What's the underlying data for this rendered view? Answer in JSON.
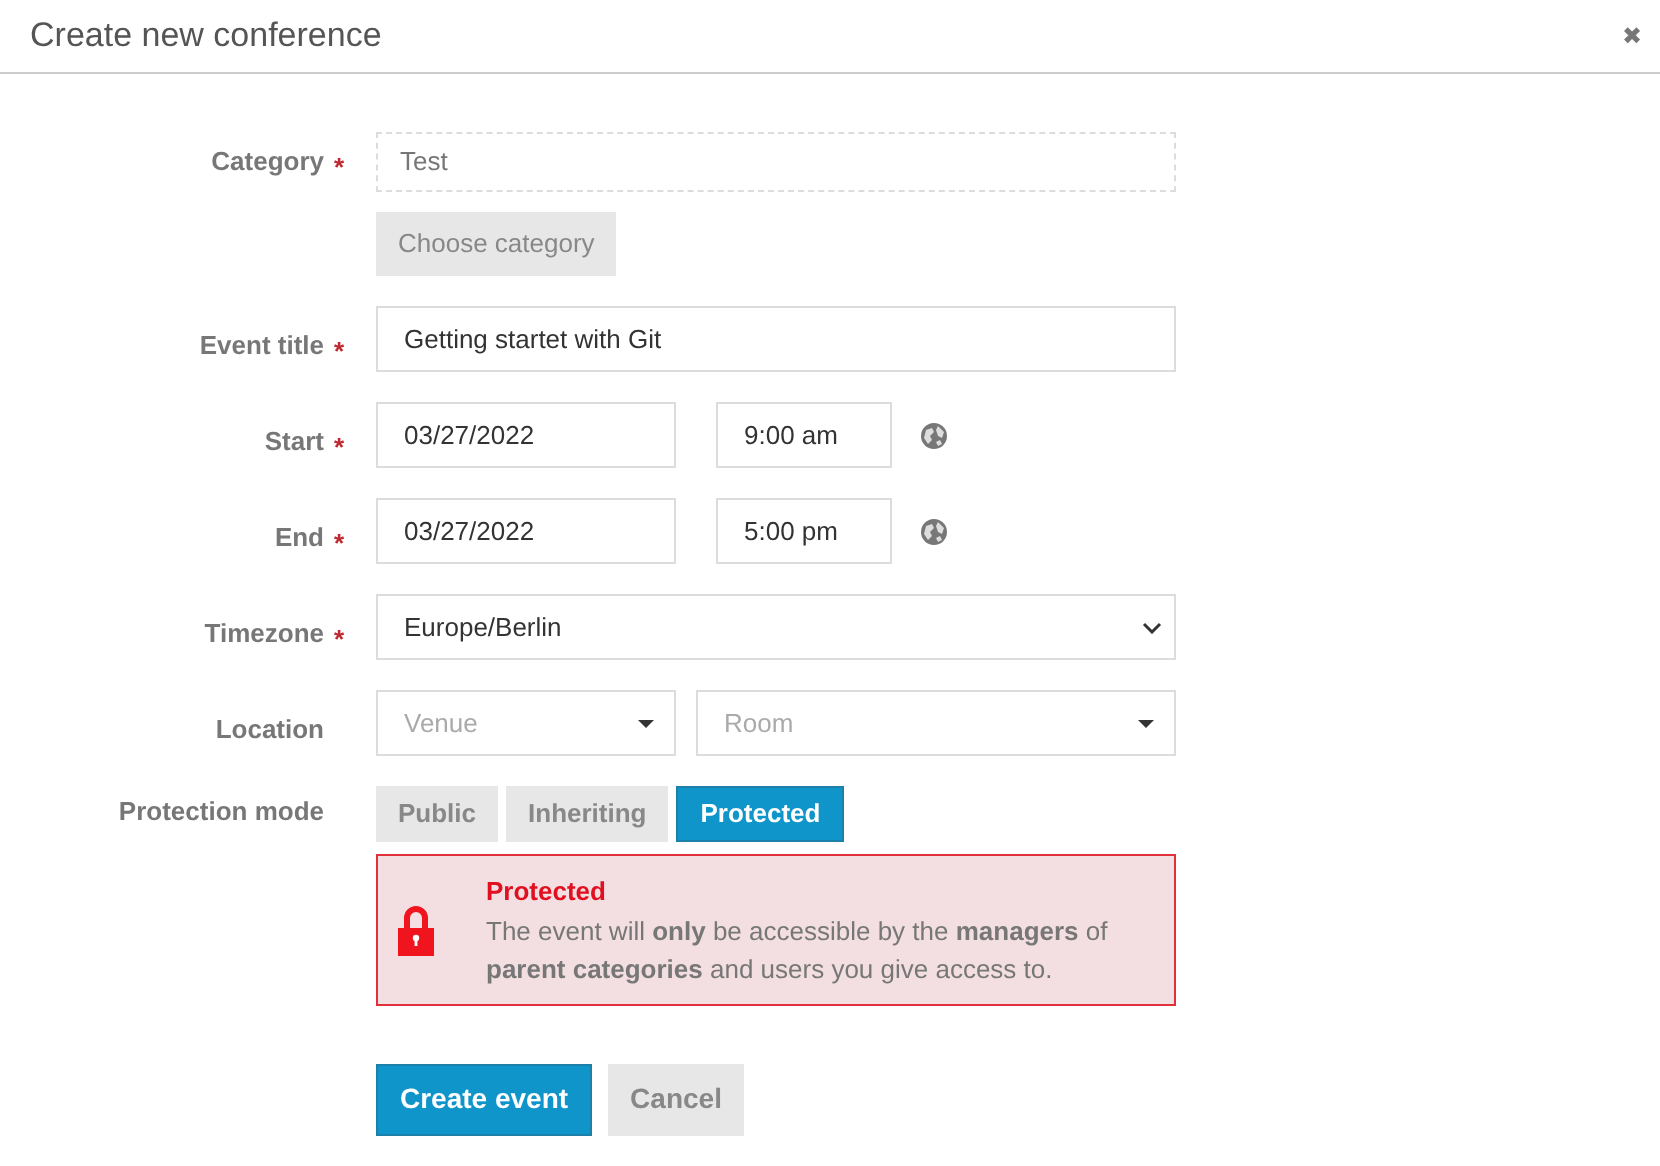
{
  "dialog": {
    "title": "Create new conference",
    "close": "✖"
  },
  "fields": [
    {
      "kind": "category",
      "label": "Category",
      "required": true,
      "value": "Test",
      "button": "Choose category"
    },
    {
      "kind": "text",
      "label": "Event title",
      "required": true,
      "value": "Getting startet with Git"
    },
    {
      "kind": "datetime",
      "label": "Start",
      "required": true,
      "date": "03/27/2022",
      "time": "9:00 am"
    },
    {
      "kind": "datetime",
      "label": "End",
      "required": true,
      "date": "03/27/2022",
      "time": "5:00 pm"
    },
    {
      "kind": "select",
      "label": "Timezone",
      "required": true,
      "value": "Europe/Berlin"
    },
    {
      "kind": "location",
      "label": "Location",
      "required": false,
      "venue_placeholder": "Venue",
      "room_placeholder": "Room"
    },
    {
      "kind": "protection",
      "label": "Protection mode",
      "required": false,
      "options": [
        {
          "label": "Public",
          "selected": false
        },
        {
          "label": "Inheriting",
          "selected": false
        },
        {
          "label": "Protected",
          "selected": true
        }
      ],
      "notice": {
        "title": "Protected",
        "text": "The event will **only** be accessible by the **managers** of **parent categories** and users you give access to."
      }
    }
  ],
  "required_mark": "*",
  "actions": [
    {
      "label": "Create event",
      "primary": true
    },
    {
      "label": "Cancel",
      "primary": false
    }
  ]
}
